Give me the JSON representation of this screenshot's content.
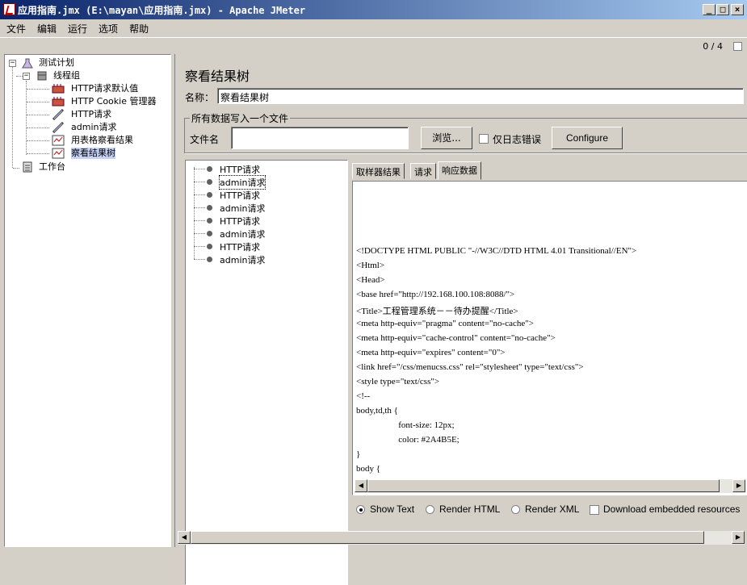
{
  "window": {
    "title": "应用指南.jmx (E:\\mayan\\应用指南.jmx) - Apache JMeter"
  },
  "menu": [
    "文件",
    "编辑",
    "运行",
    "选项",
    "帮助"
  ],
  "status": {
    "counter": "0 / 4"
  },
  "tree": {
    "root": "测试计划",
    "thread_group": "线程组",
    "children": [
      "HTTP请求默认值",
      "HTTP Cookie 管理器",
      "HTTP请求",
      "admin请求",
      "用表格察看结果",
      "察看结果树"
    ],
    "workbench": "工作台"
  },
  "panel": {
    "title": "察看结果树",
    "name_label": "名称：",
    "name_value": "察看结果树",
    "group_title": "所有数据写入一个文件",
    "file_label": "文件名",
    "file_value": "",
    "browse_label": "浏览...",
    "errors_only_label": "仅日志错误",
    "configure_label": "Configure"
  },
  "results": [
    "HTTP请求",
    "admin请求",
    "HTTP请求",
    "admin请求",
    "HTTP请求",
    "admin请求",
    "HTTP请求",
    "admin请求"
  ],
  "tabs": [
    "取样器结果",
    "请求",
    "响应数据"
  ],
  "response_lines": [
    "<!DOCTYPE HTML PUBLIC \"-//W3C//DTD HTML 4.01 Transitional//EN\">",
    "<Html>",
    "<Head>",
    "<base href=\"http://192.168.100.108:8088/\">",
    "<Title>工程管理系统－－待办提醒</Title>",
    "<meta http-equiv=\"pragma\" content=\"no-cache\">",
    "<meta http-equiv=\"cache-control\" content=\"no-cache\">",
    "<meta http-equiv=\"expires\" content=\"0\">",
    "<link href=\"/css/menucss.css\" rel=\"stylesheet\" type=\"text/css\">",
    "<style type=\"text/css\">",
    "<!--",
    "body,td,th {",
    "                   font-size: 12px;",
    "                   color: #2A4B5E;",
    "}",
    "body {"
  ],
  "render_options": {
    "show_text": "Show Text",
    "render_html": "Render HTML",
    "render_xml": "Render XML",
    "download": "Download embedded resources"
  }
}
